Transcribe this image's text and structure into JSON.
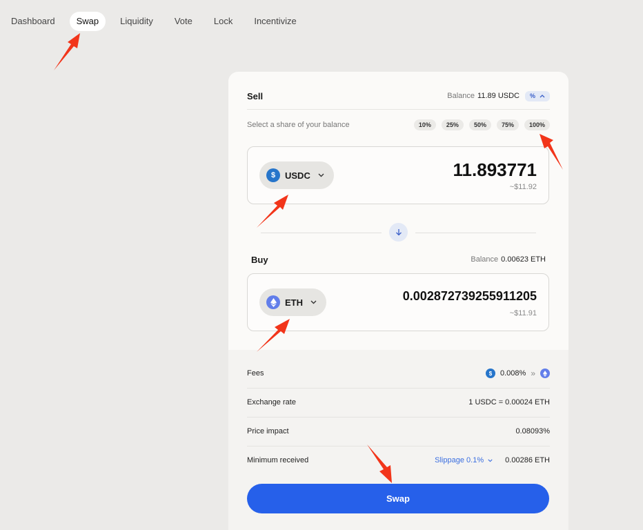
{
  "nav": {
    "items": [
      "Dashboard",
      "Swap",
      "Liquidity",
      "Vote",
      "Lock",
      "Incentivize"
    ],
    "active": "Swap"
  },
  "sell": {
    "label": "Sell",
    "balance_label": "Balance",
    "balance_value": "11.89 USDC",
    "toggle_label": "%",
    "share_hint": "Select a share of your balance",
    "shares": [
      "10%",
      "25%",
      "50%",
      "75%",
      "100%"
    ],
    "token": "USDC",
    "amount": "11.893771",
    "amount_usd": "~$11.92"
  },
  "buy": {
    "label": "Buy",
    "balance_label": "Balance",
    "balance_value": "0.00623 ETH",
    "token": "ETH",
    "amount": "0.002872739255911205",
    "amount_usd": "~$11.91"
  },
  "details": {
    "fees_label": "Fees",
    "fees_value": "0.008%",
    "exchange_label": "Exchange rate",
    "exchange_value": "1 USDC = 0.00024 ETH",
    "impact_label": "Price impact",
    "impact_value": "0.08093%",
    "min_label": "Minimum received",
    "slippage": "Slippage 0.1%",
    "min_value": "0.00286 ETH"
  },
  "swap_button": "Swap",
  "colors": {
    "accent": "#2660ea",
    "usdc": "#2775ca",
    "eth": "#627eea",
    "annotation": "#f2351a"
  }
}
